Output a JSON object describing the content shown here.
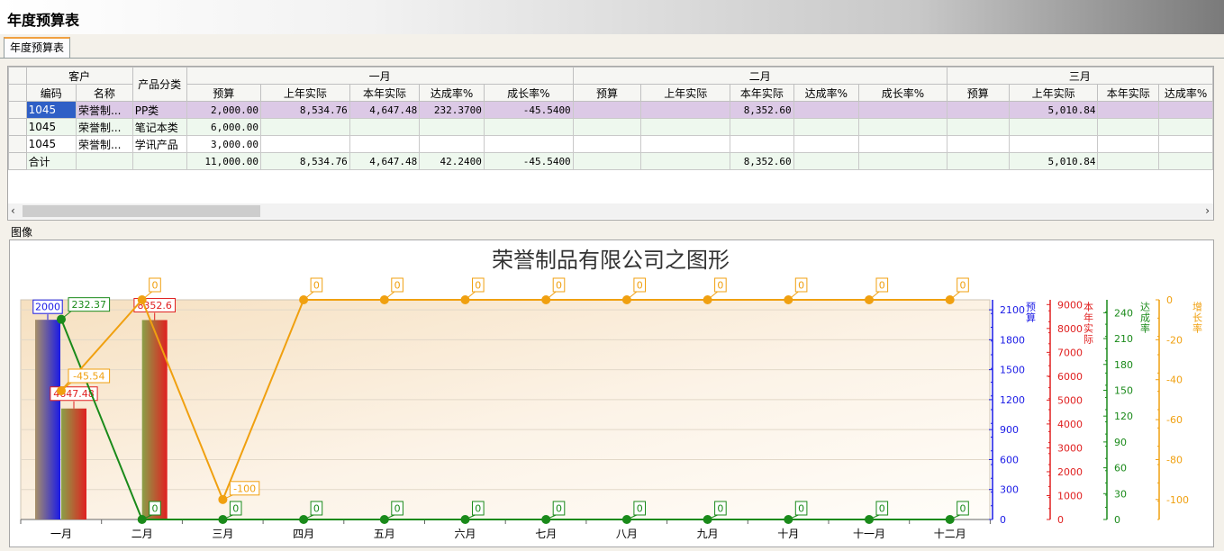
{
  "window": {
    "title": "年度预算表"
  },
  "tab": {
    "label": "年度预算表"
  },
  "grid": {
    "group_headers": {
      "customer": "客户",
      "product": "产品分类",
      "months": [
        "一月",
        "二月",
        "三月"
      ]
    },
    "sub_headers": {
      "code": "编码",
      "name": "名称",
      "cols": [
        "预算",
        "上年实际",
        "本年实际",
        "达成率%",
        "成长率%"
      ]
    },
    "rows": [
      {
        "code": "1045",
        "name": "荣誉制...",
        "cat": "PP类",
        "m1": [
          "2,000.00",
          "8,534.76",
          "4,647.48",
          "232.3700",
          "-45.5400"
        ],
        "m2": [
          "",
          "",
          "8,352.60",
          "",
          ""
        ],
        "m3": [
          "",
          "5,010.84",
          "",
          ""
        ]
      },
      {
        "code": "1045",
        "name": "荣誉制...",
        "cat": "笔记本类",
        "m1": [
          "6,000.00",
          "",
          "",
          "",
          ""
        ],
        "m2": [
          "",
          "",
          "",
          "",
          ""
        ],
        "m3": [
          "",
          "",
          "",
          ""
        ]
      },
      {
        "code": "1045",
        "name": "荣誉制...",
        "cat": "学讯产品",
        "m1": [
          "3,000.00",
          "",
          "",
          "",
          ""
        ],
        "m2": [
          "",
          "",
          "",
          "",
          ""
        ],
        "m3": [
          "",
          "",
          "",
          ""
        ]
      },
      {
        "code": "合计",
        "name": "",
        "cat": "",
        "m1": [
          "11,000.00",
          "8,534.76",
          "4,647.48",
          "42.2400",
          "-45.5400"
        ],
        "m2": [
          "",
          "",
          "8,352.60",
          "",
          ""
        ],
        "m3": [
          "",
          "5,010.84",
          "",
          ""
        ]
      }
    ]
  },
  "scroll": {
    "left_arrow": "‹",
    "right_arrow": "›"
  },
  "image_panel": {
    "label": "图像"
  },
  "chart_data": {
    "type": "bar+line",
    "title": "荣誉制品有限公司之图形",
    "categories": [
      "一月",
      "二月",
      "三月",
      "四月",
      "五月",
      "六月",
      "七月",
      "八月",
      "九月",
      "十月",
      "十一月",
      "十二月"
    ],
    "series": [
      {
        "name": "预算",
        "kind": "bar",
        "axis": "budget",
        "color": "#1a1ae6",
        "values": [
          2000,
          null,
          null,
          null,
          null,
          null,
          null,
          null,
          null,
          null,
          null,
          null
        ],
        "labels": [
          "2000",
          "",
          "",
          "",
          "",
          "",
          "",
          "",
          "",
          "",
          "",
          ""
        ]
      },
      {
        "name": "本年实际",
        "kind": "bar",
        "axis": "actual",
        "color": "#e02020",
        "values": [
          4647.48,
          8352.6,
          null,
          null,
          null,
          null,
          null,
          null,
          null,
          null,
          null,
          null
        ],
        "labels": [
          "4647.48",
          "8352.6",
          "",
          "",
          "",
          "",
          "",
          "",
          "",
          "",
          "",
          ""
        ]
      },
      {
        "name": "达成率",
        "kind": "line",
        "axis": "rate",
        "color": "#1a8a1a",
        "values": [
          232.37,
          0,
          0,
          0,
          0,
          0,
          0,
          0,
          0,
          0,
          0,
          0
        ],
        "labels": [
          "232.37",
          "0",
          "0",
          "0",
          "0",
          "0",
          "0",
          "0",
          "0",
          "0",
          "0",
          "0"
        ]
      },
      {
        "name": "增长率",
        "kind": "line",
        "axis": "growth",
        "color": "#f0a010",
        "values": [
          -45.54,
          0,
          -100,
          0,
          0,
          0,
          0,
          0,
          0,
          0,
          0,
          0
        ],
        "labels": [
          "-45.54",
          "0",
          "-100",
          "0",
          "0",
          "0",
          "0",
          "0",
          "0",
          "0",
          "0",
          "0"
        ]
      }
    ],
    "axes": [
      {
        "id": "budget",
        "name": "预算",
        "color": "#1a1ae6",
        "ylim": [
          0,
          2200
        ],
        "ticks": [
          "0",
          "300",
          "600",
          "900",
          "1200",
          "1500",
          "1800",
          "2100"
        ],
        "tickvals": [
          0,
          300,
          600,
          900,
          1200,
          1500,
          1800,
          2100
        ]
      },
      {
        "id": "actual",
        "name": "本年实际",
        "color": "#e02020",
        "ylim": [
          0,
          9200
        ],
        "ticks": [
          "0",
          "1000",
          "2000",
          "3000",
          "4000",
          "5000",
          "6000",
          "7000",
          "8000",
          "9000"
        ],
        "tickvals": [
          0,
          1000,
          2000,
          3000,
          4000,
          5000,
          6000,
          7000,
          8000,
          9000
        ]
      },
      {
        "id": "rate",
        "name": "达成率",
        "color": "#1a8a1a",
        "ylim": [
          0,
          255
        ],
        "ticks": [
          "0",
          "30",
          "60",
          "90",
          "120",
          "150",
          "180",
          "210",
          "240"
        ],
        "tickvals": [
          0,
          30,
          60,
          90,
          120,
          150,
          180,
          210,
          240
        ]
      },
      {
        "id": "growth",
        "name": "增长率",
        "color": "#f0a010",
        "ylim": [
          -110,
          0
        ],
        "ticks": [
          "-100",
          "-80",
          "-60",
          "-40",
          "-20",
          "0"
        ],
        "tickvals": [
          -100,
          -80,
          -60,
          -40,
          -20,
          0
        ]
      }
    ],
    "grid": true
  }
}
